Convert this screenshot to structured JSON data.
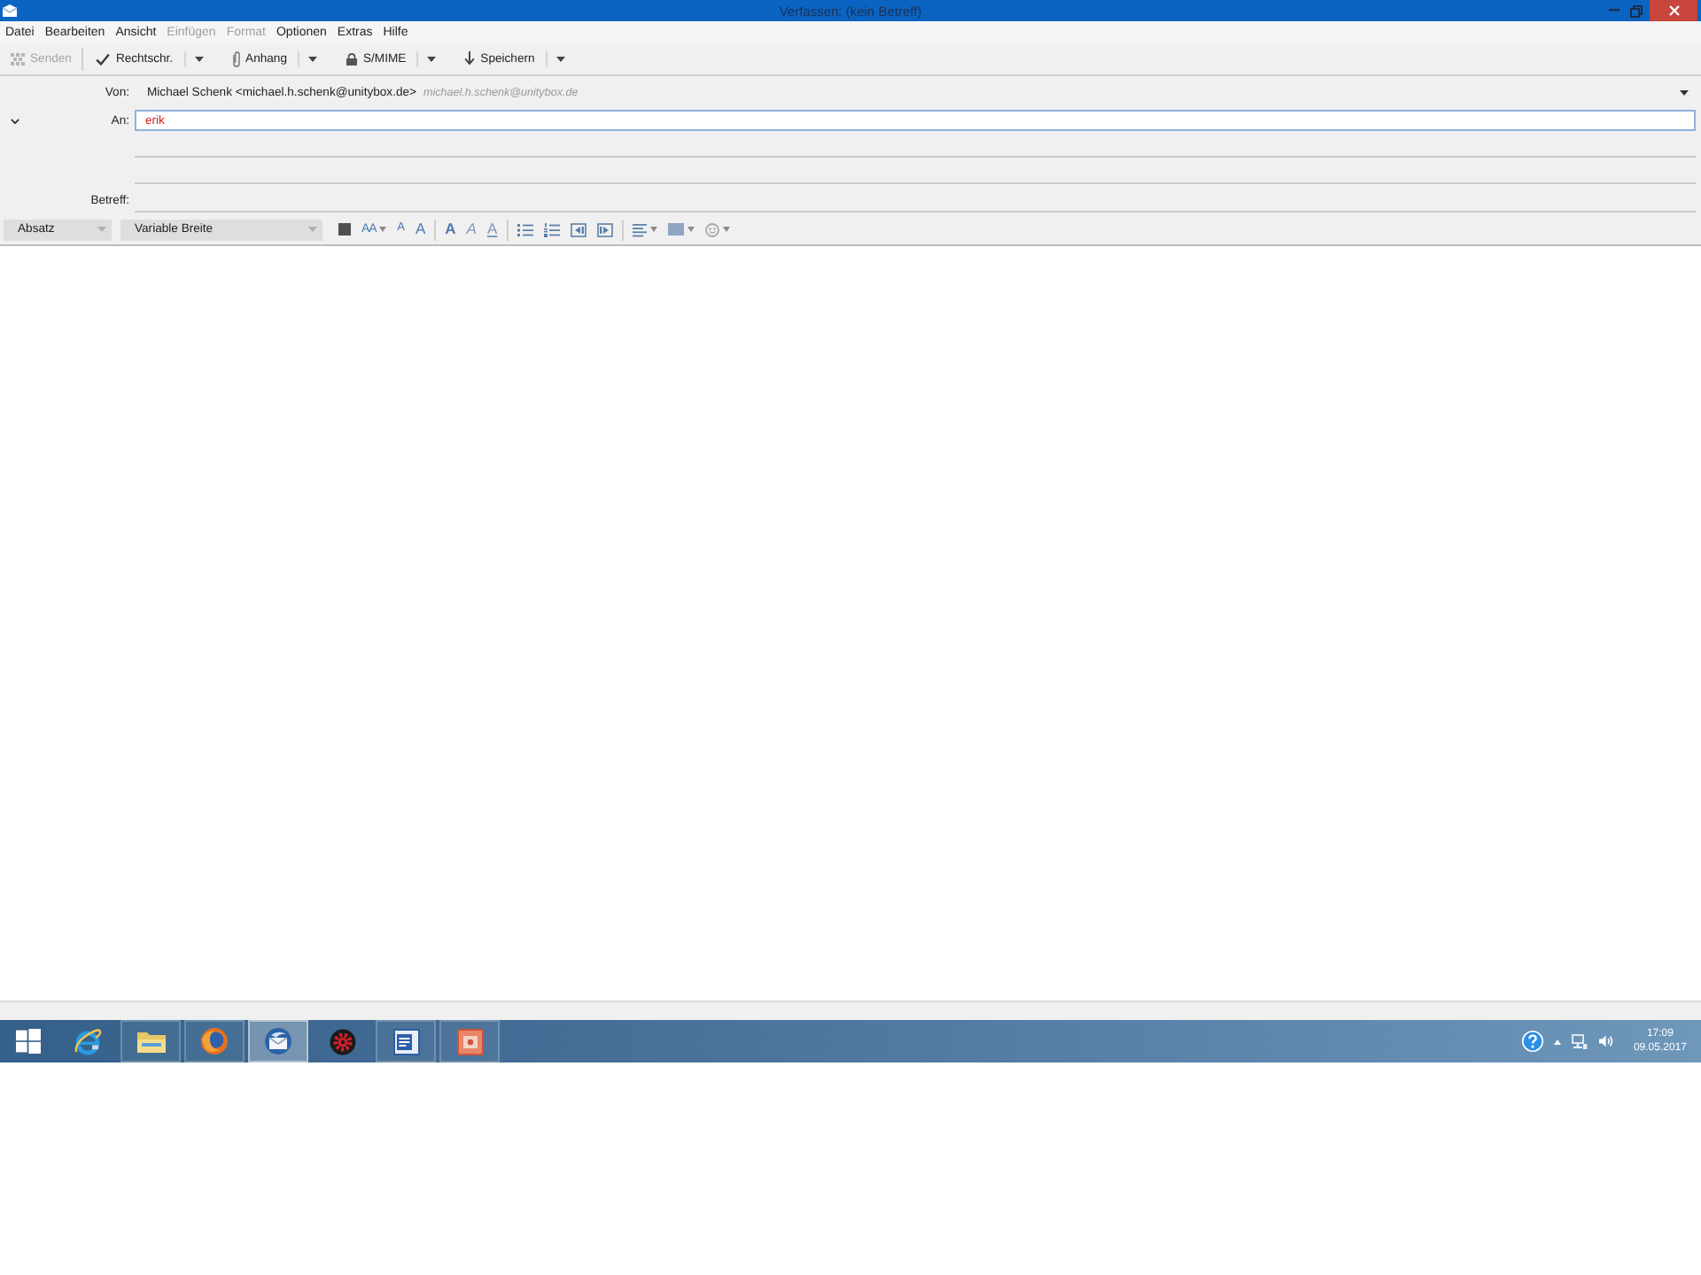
{
  "window": {
    "title": "Verfassen: (kein Betreff)"
  },
  "menu": [
    {
      "label": "Datei",
      "disabled": false
    },
    {
      "label": "Bearbeiten",
      "disabled": false
    },
    {
      "label": "Ansicht",
      "disabled": false
    },
    {
      "label": "Einfügen",
      "disabled": true
    },
    {
      "label": "Format",
      "disabled": true
    },
    {
      "label": "Optionen",
      "disabled": false
    },
    {
      "label": "Extras",
      "disabled": false
    },
    {
      "label": "Hilfe",
      "disabled": false
    }
  ],
  "toolbar": [
    [
      {
        "kind": "send",
        "label": "Senden",
        "disabled": true,
        "dropdown": false
      }
    ],
    [
      {
        "kind": "spelling",
        "label": "Rechtschr.",
        "disabled": false,
        "dropdown": true
      },
      {
        "kind": "attach",
        "label": "Anhang",
        "disabled": false,
        "dropdown": true
      },
      {
        "kind": "security",
        "label": "S/MIME",
        "disabled": false,
        "dropdown": true
      },
      {
        "kind": "save",
        "label": "Speichern",
        "disabled": false,
        "dropdown": true
      }
    ]
  ],
  "header": {
    "from": {
      "label": "Von:",
      "value": "Michael Schenk <michael.h.schenk@unitybox.de>",
      "identity": "michael.h.schenk@unitybox.de"
    },
    "address_rows": [
      {
        "kind": "address",
        "label": "An:",
        "value": "erik",
        "invalid": true
      },
      {
        "kind": "blank"
      },
      {
        "kind": "blank"
      }
    ],
    "subject": {
      "label": "Betreff:"
    }
  },
  "format_bar": {
    "paragraph": "Absatz",
    "font": "Variable Breite",
    "groups": [
      [
        {
          "kind": "color",
          "dropdown": false
        },
        {
          "kind": "size",
          "label": "AA",
          "dropdown": true
        },
        {
          "kind": "smaller",
          "label": "A",
          "dropdown": false
        },
        {
          "kind": "larger",
          "label": "A",
          "dropdown": false
        }
      ],
      [
        {
          "kind": "bold",
          "label": "A",
          "dropdown": false
        },
        {
          "kind": "italic",
          "label": "A",
          "dropdown": false
        },
        {
          "kind": "underline",
          "label": "A",
          "dropdown": false
        }
      ],
      [
        {
          "kind": "bullets",
          "dropdown": false
        },
        {
          "kind": "numbers",
          "dropdown": false
        },
        {
          "kind": "outdent",
          "dropdown": false
        },
        {
          "kind": "indent",
          "dropdown": false
        }
      ],
      [
        {
          "kind": "align",
          "dropdown": true
        },
        {
          "kind": "insert",
          "dropdown": true
        },
        {
          "kind": "emoji",
          "dropdown": true
        }
      ]
    ]
  },
  "taskbar": {
    "apps": [
      {
        "kind": "e-browser",
        "selected": false,
        "running": false
      },
      {
        "kind": "folder",
        "selected": false,
        "running": true
      },
      {
        "kind": "globe",
        "selected": false,
        "running": true
      },
      {
        "kind": "mail",
        "selected": true,
        "running": true
      },
      {
        "kind": "gear",
        "selected": false,
        "running": false
      },
      {
        "kind": "document",
        "selected": false,
        "running": true
      },
      {
        "kind": "slides",
        "selected": false,
        "running": true
      }
    ],
    "tray": {
      "time": "17:09",
      "date": "09.05.2017"
    }
  }
}
